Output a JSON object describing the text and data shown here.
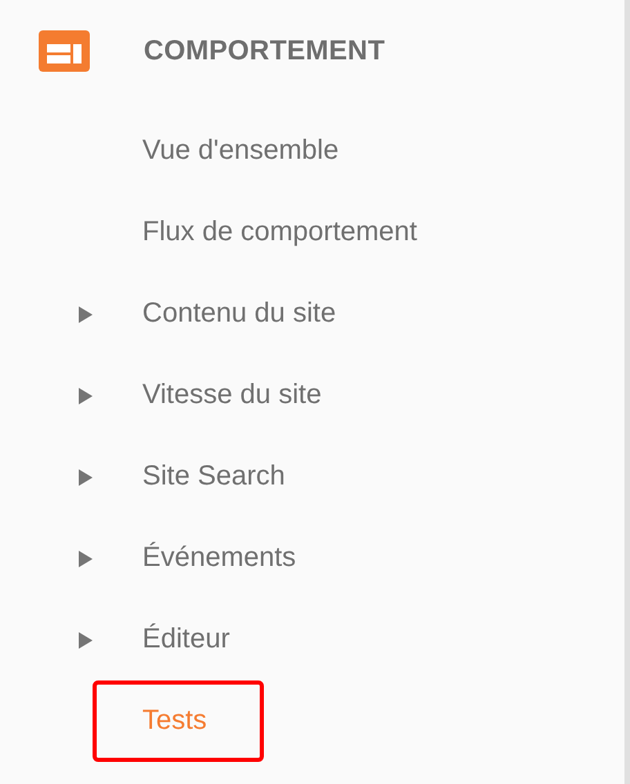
{
  "section": {
    "title": "COMPORTEMENT"
  },
  "items": [
    {
      "label": "Vue d'ensemble",
      "kind": "leaf",
      "selected": false,
      "highlighted": false
    },
    {
      "label": "Flux de comportement",
      "kind": "leaf",
      "selected": false,
      "highlighted": false
    },
    {
      "label": "Contenu du site",
      "kind": "expandable",
      "selected": false,
      "highlighted": false
    },
    {
      "label": "Vitesse du site",
      "kind": "expandable",
      "selected": false,
      "highlighted": false
    },
    {
      "label": "Site Search",
      "kind": "expandable",
      "selected": false,
      "highlighted": false
    },
    {
      "label": "Événements",
      "kind": "expandable",
      "selected": false,
      "highlighted": false
    },
    {
      "label": "Éditeur",
      "kind": "expandable",
      "selected": false,
      "highlighted": false
    },
    {
      "label": "Tests",
      "kind": "leaf",
      "selected": true,
      "highlighted": true
    }
  ]
}
